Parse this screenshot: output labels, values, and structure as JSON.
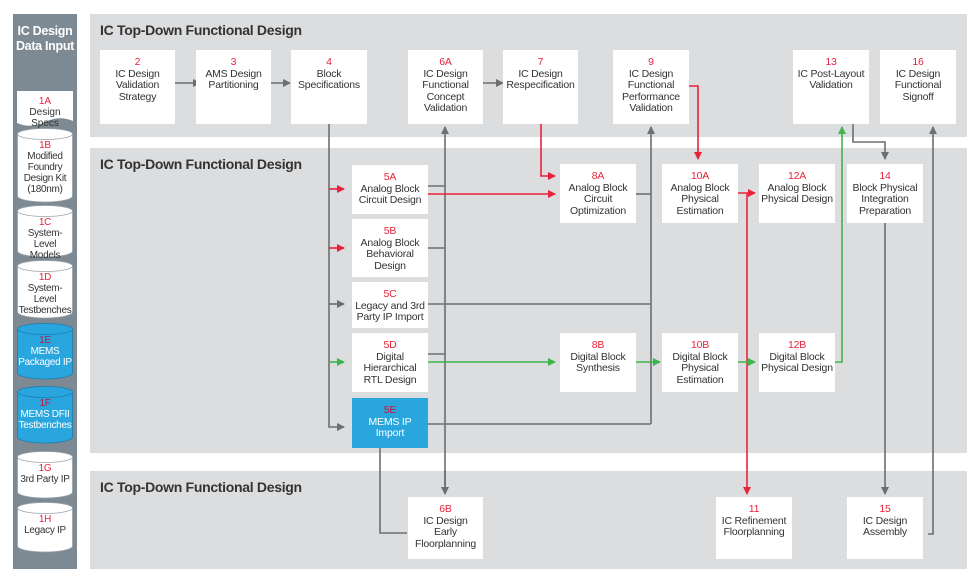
{
  "sidebar": {
    "title_line1": "IC Design",
    "title_line2": "Data Input",
    "items": [
      {
        "id": "1A",
        "lines": [
          "Design",
          "Specs"
        ],
        "shape": "document",
        "style": "white"
      },
      {
        "id": "1B",
        "lines": [
          "Modified",
          "Foundry",
          "Design Kit",
          "(180nm)"
        ],
        "shape": "cylinder",
        "style": "white"
      },
      {
        "id": "1C",
        "lines": [
          "System-Level",
          "Models"
        ],
        "shape": "cylinder",
        "style": "white"
      },
      {
        "id": "1D",
        "lines": [
          "System-Level",
          "Testbenches"
        ],
        "shape": "cylinder",
        "style": "white"
      },
      {
        "id": "1E",
        "lines": [
          "MEMS",
          "Packaged IP"
        ],
        "shape": "cylinder",
        "style": "blue"
      },
      {
        "id": "1F",
        "lines": [
          "MEMS DFII",
          "Testbenches"
        ],
        "shape": "cylinder",
        "style": "blue"
      },
      {
        "id": "1G",
        "lines": [
          "3rd Party IP"
        ],
        "shape": "cylinder",
        "style": "white"
      },
      {
        "id": "1H",
        "lines": [
          "Legacy IP"
        ],
        "shape": "cylinder",
        "style": "white"
      }
    ]
  },
  "bands": [
    {
      "title": "IC Top-Down Functional Design"
    },
    {
      "title": "IC Top-Down Functional Design"
    },
    {
      "title": "IC Top-Down Functional Design"
    }
  ],
  "steps": {
    "s2": {
      "id": "2",
      "lines": [
        "IC Design",
        "Validation",
        "Strategy"
      ]
    },
    "s3": {
      "id": "3",
      "lines": [
        "AMS Design",
        "Partitioning"
      ]
    },
    "s4": {
      "id": "4",
      "lines": [
        "Block",
        "Specifications"
      ]
    },
    "s6A": {
      "id": "6A",
      "lines": [
        "IC Design",
        "Functional",
        "Concept",
        "Validation"
      ]
    },
    "s7": {
      "id": "7",
      "lines": [
        "IC Design",
        "Respecification"
      ]
    },
    "s9": {
      "id": "9",
      "lines": [
        "IC Design",
        "Functional",
        "Performance",
        "Validation"
      ]
    },
    "s13": {
      "id": "13",
      "lines": [
        "IC Post-Layout",
        "Validation"
      ]
    },
    "s16": {
      "id": "16",
      "lines": [
        "IC Design",
        "Functional",
        "Signoff"
      ]
    },
    "s5A": {
      "id": "5A",
      "lines": [
        "Analog Block",
        "Circuit Design"
      ]
    },
    "s5B": {
      "id": "5B",
      "lines": [
        "Analog Block",
        "Behavioral",
        "Design"
      ]
    },
    "s5C": {
      "id": "5C",
      "lines": [
        "Legacy and 3rd",
        "Party IP Import"
      ]
    },
    "s5D": {
      "id": "5D",
      "lines": [
        "Digital",
        "Hierarchical",
        "RTL Design"
      ]
    },
    "s5E": {
      "id": "5E",
      "lines": [
        "MEMS IP",
        "Import"
      ]
    },
    "s8A": {
      "id": "8A",
      "lines": [
        "Analog Block",
        "Circuit",
        "Optimization"
      ]
    },
    "s8B": {
      "id": "8B",
      "lines": [
        "Digital Block",
        "Synthesis"
      ]
    },
    "s10A": {
      "id": "10A",
      "lines": [
        "Analog Block",
        "Physical",
        "Estimation"
      ]
    },
    "s10B": {
      "id": "10B",
      "lines": [
        "Digital Block",
        "Physical",
        "Estimation"
      ]
    },
    "s12A": {
      "id": "12A",
      "lines": [
        "Analog Block",
        "Physical Design"
      ]
    },
    "s12B": {
      "id": "12B",
      "lines": [
        "Digital Block",
        "Physical Design"
      ]
    },
    "s14": {
      "id": "14",
      "lines": [
        "Block Physical",
        "Integration",
        "Preparation"
      ]
    },
    "s6B": {
      "id": "6B",
      "lines": [
        "IC Design",
        "Early",
        "Floorplanning"
      ]
    },
    "s11": {
      "id": "11",
      "lines": [
        "IC Refinement",
        "Floorplanning"
      ]
    },
    "s15": {
      "id": "15",
      "lines": [
        "IC Design",
        "Assembly"
      ]
    }
  },
  "colors": {
    "step_number": "#e8223b",
    "analog_flow": "#e8223b",
    "digital_flow": "#3cb54a",
    "general_flow": "#6d6e70",
    "mems_fill": "#2aa6df",
    "band_fill": "#dcdddf",
    "sidebar_fill": "#7d8a93"
  }
}
